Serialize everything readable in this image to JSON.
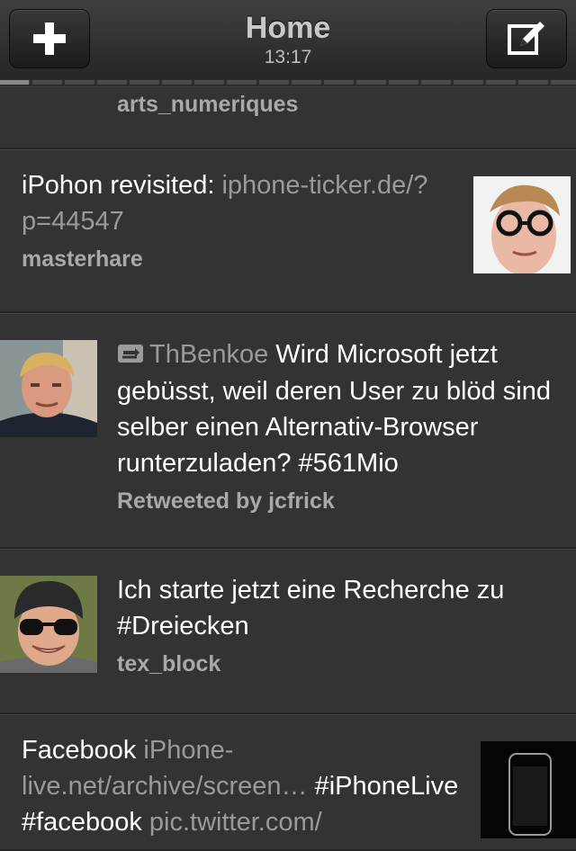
{
  "navbar": {
    "title": "Home",
    "time": "13:17",
    "left_button_icon": "plus-icon",
    "right_button_icon": "compose-icon"
  },
  "progress": {
    "fraction": 0.05
  },
  "tweets": [
    {
      "author": "arts_numeriques"
    },
    {
      "text": "iPohon revisited: ",
      "link": "iphone-ticker.de/?p=44547",
      "author": "masterhare",
      "avatar_icon": "avatar-glasses"
    },
    {
      "retweet_icon": "retweet-icon",
      "retweeted_user": "ThBenkoe",
      "text": " Wird Microsoft jetzt gebüsst, weil deren User zu blöd sind selber einen Alternativ-Browser runterzuladen? #561Mio",
      "retweet_label": "Retweeted by jcfrick",
      "avatar_icon": "avatar-blond"
    },
    {
      "text": "Ich starte jetzt eine Recherche zu #Dreiecken",
      "author": "tex_block",
      "avatar_icon": "avatar-sunglasses"
    },
    {
      "text_a": "Facebook  ",
      "link_a": "iPhone-live.net/archive/screen…",
      "text_b": " #iPhoneLive #facebook ",
      "link_b": "pic.twitter.com/",
      "avatar_icon": "avatar-iphone"
    }
  ],
  "colors": {
    "background": "#333333",
    "text": "#ffffff",
    "secondary": "#9a9a9a"
  }
}
